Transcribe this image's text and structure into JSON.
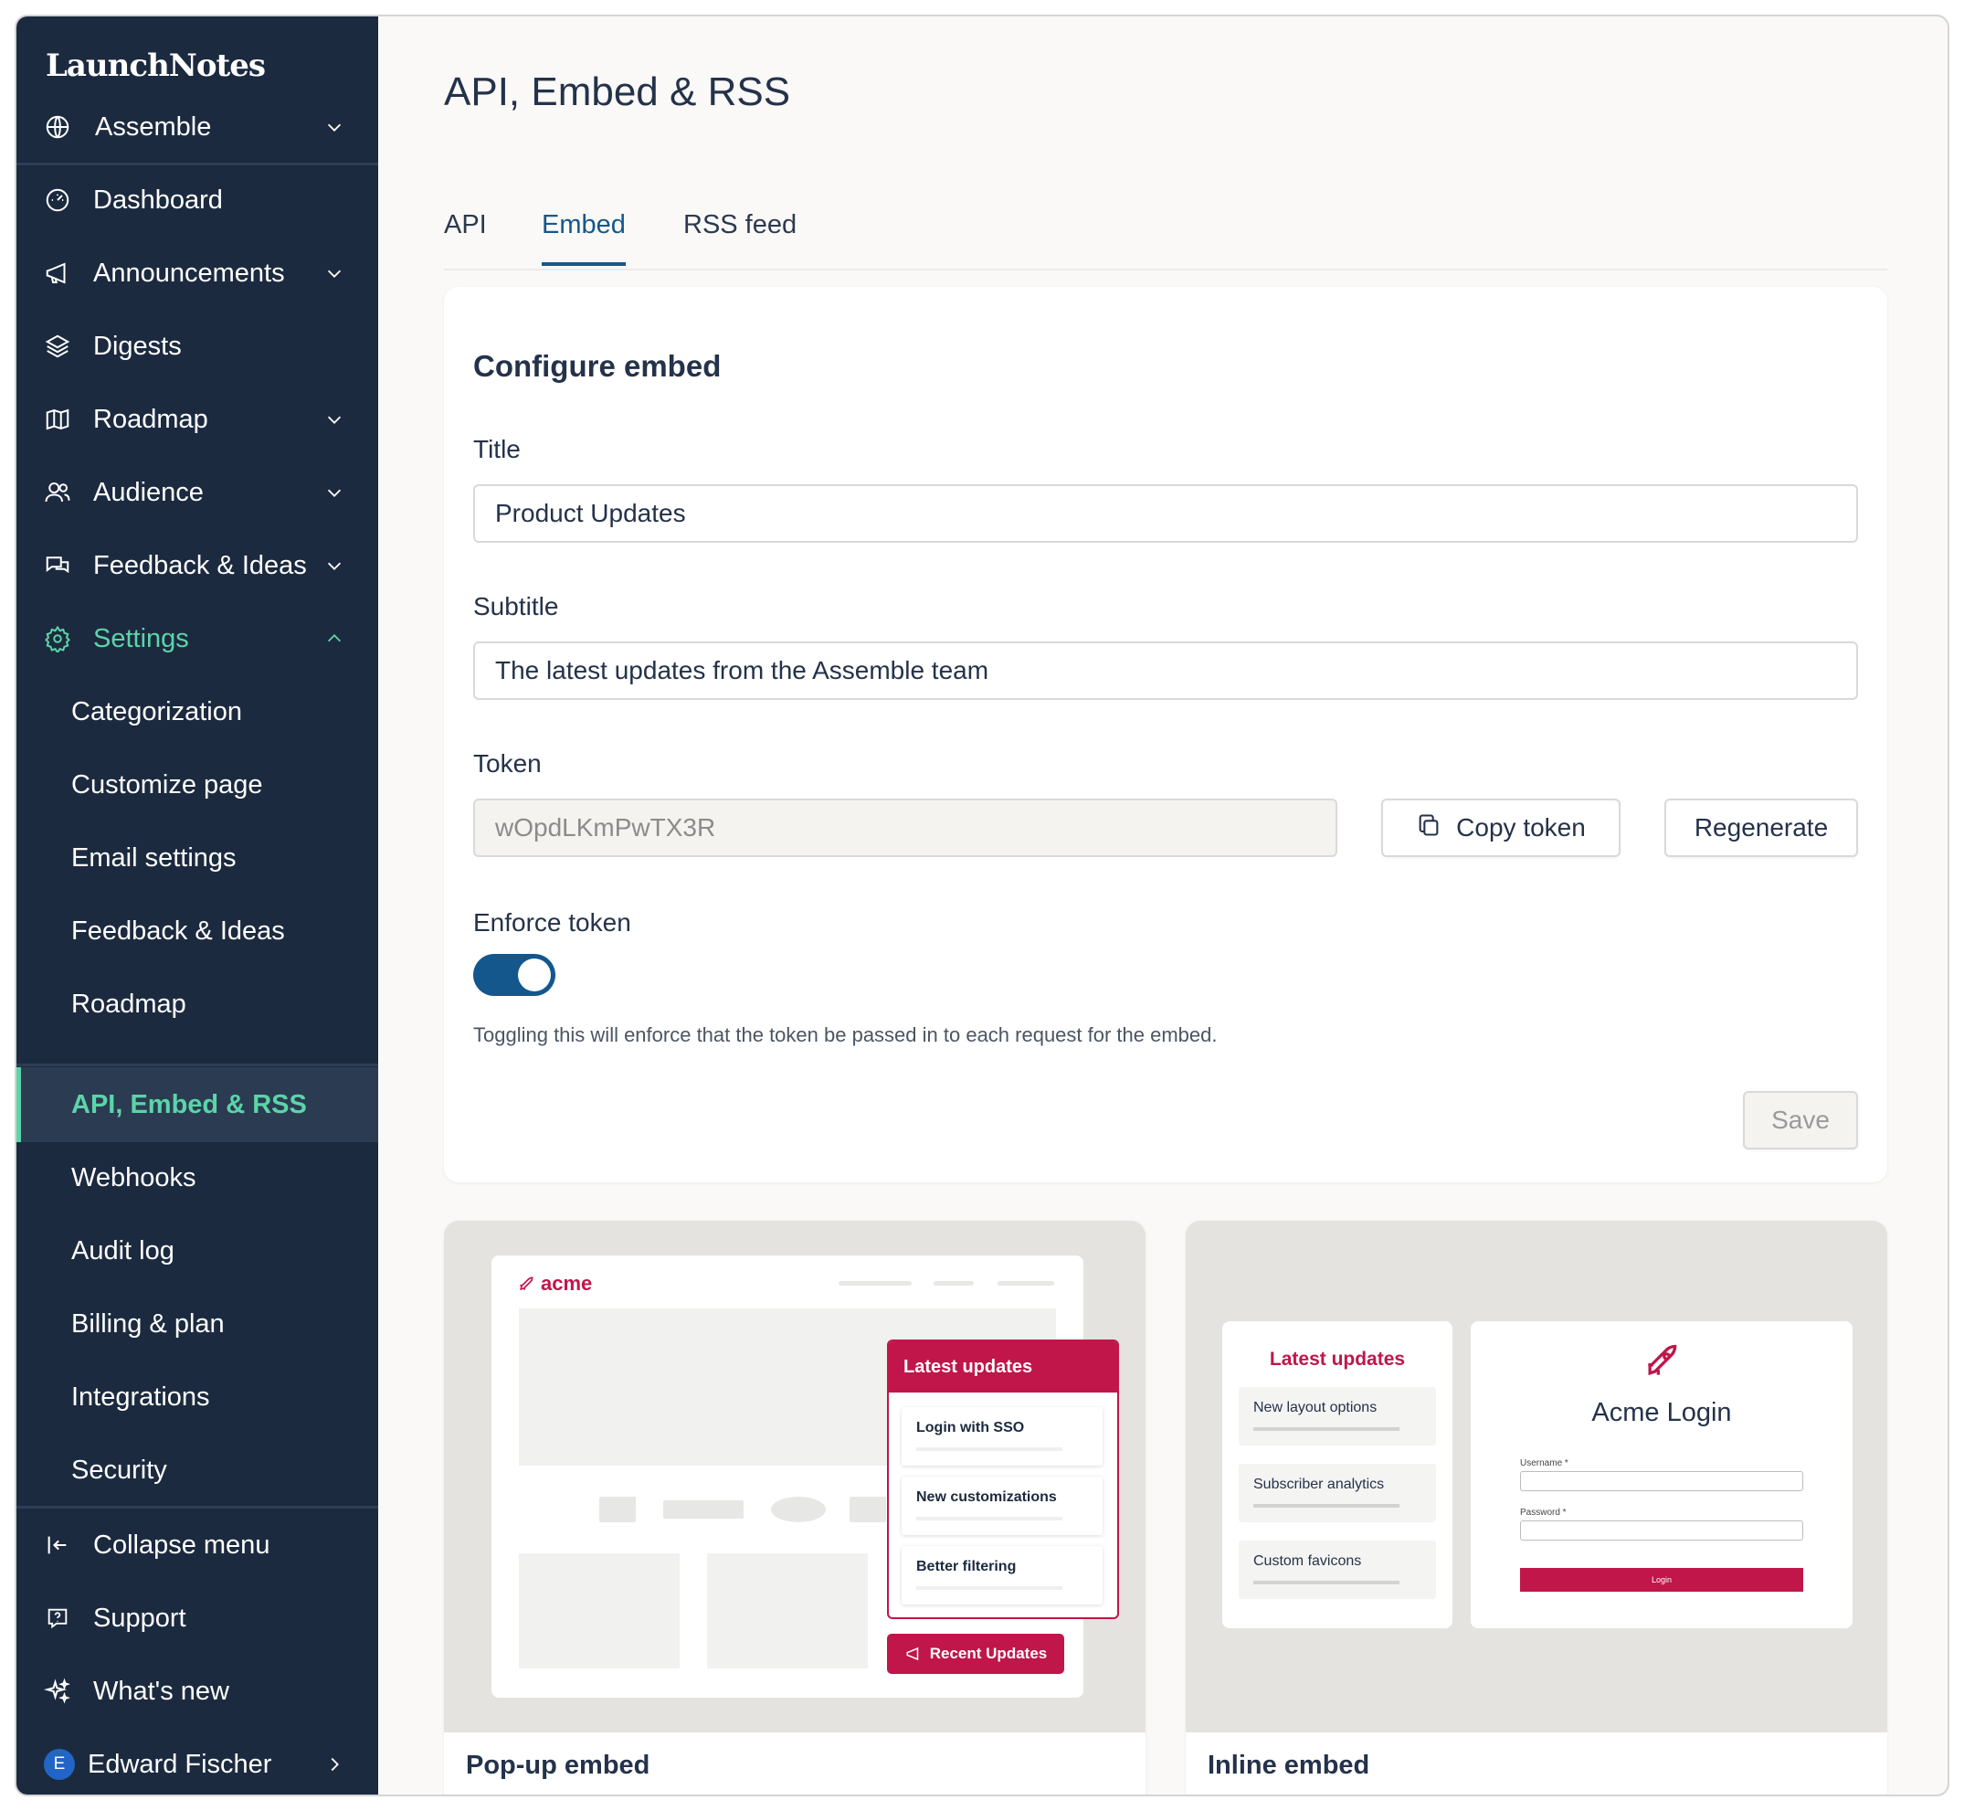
{
  "app": {
    "logo": "LaunchNotes"
  },
  "sidebar": {
    "workspace": "Assemble",
    "items": [
      {
        "label": "Dashboard"
      },
      {
        "label": "Announcements"
      },
      {
        "label": "Digests"
      },
      {
        "label": "Roadmap"
      },
      {
        "label": "Audience"
      },
      {
        "label": "Feedback & Ideas"
      },
      {
        "label": "Settings"
      }
    ],
    "settings_items": [
      {
        "label": "Categorization"
      },
      {
        "label": "Customize page"
      },
      {
        "label": "Email settings"
      },
      {
        "label": "Feedback & Ideas"
      },
      {
        "label": "Roadmap"
      },
      {
        "label": "API, Embed & RSS"
      },
      {
        "label": "Webhooks"
      },
      {
        "label": "Audit log"
      },
      {
        "label": "Billing & plan"
      },
      {
        "label": "Integrations"
      },
      {
        "label": "Security"
      }
    ],
    "footer": {
      "collapse": "Collapse menu",
      "support": "Support",
      "whats_new": "What's new",
      "user_initial": "E",
      "user_name": "Edward Fischer"
    },
    "accent_color": "#5cd4a8"
  },
  "page": {
    "title": "API, Embed & RSS",
    "tabs": [
      {
        "label": "API"
      },
      {
        "label": "Embed"
      },
      {
        "label": "RSS feed"
      }
    ],
    "active_tab": "Embed"
  },
  "config": {
    "heading": "Configure embed",
    "title_label": "Title",
    "title_value": "Product Updates",
    "subtitle_label": "Subtitle",
    "subtitle_value": "The latest updates from the Assemble team",
    "token_label": "Token",
    "token_value": "wOpdLKmPwTX3R",
    "copy_token": "Copy token",
    "regenerate": "Regenerate",
    "enforce_label": "Enforce token",
    "enforce_on": true,
    "enforce_help": "Toggling this will enforce that the token be passed in to each request for the embed.",
    "save": "Save"
  },
  "popup_preview": {
    "brand": "acme",
    "header": "Latest updates",
    "items": [
      "Login with SSO",
      "New customizations",
      "Better filtering"
    ],
    "button": "Recent Updates",
    "caption": "Pop-up embed"
  },
  "inline_preview": {
    "header": "Latest updates",
    "items": [
      "New layout options",
      "Subscriber analytics",
      "Custom favicons"
    ],
    "login_title": "Acme Login",
    "username_label": "Username *",
    "password_label": "Password *",
    "login_button": "Login",
    "caption": "Inline embed"
  },
  "colors": {
    "primary": "#14578c",
    "brand_red": "#c0164a",
    "sidebar_bg": "#1c2a3f"
  }
}
